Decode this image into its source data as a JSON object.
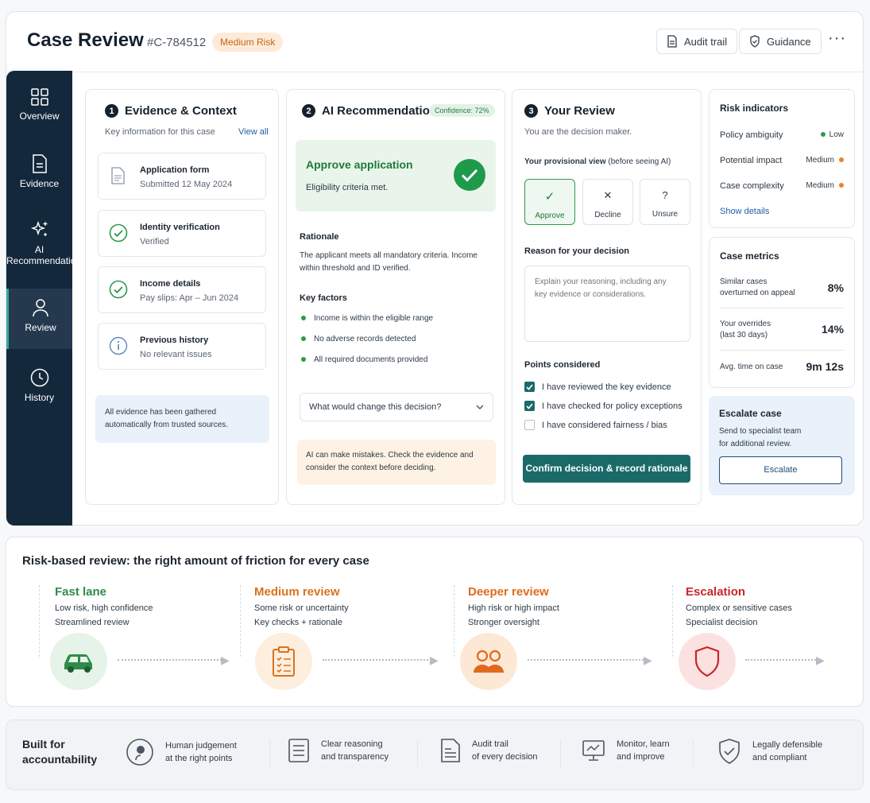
{
  "header": {
    "title": "Case Review",
    "case_id": "#C-784512",
    "risk_badge": "Medium Risk",
    "audit_trail": "Audit trail",
    "guidance": "Guidance",
    "more": "···"
  },
  "sidebar": {
    "items": [
      {
        "label": "Overview"
      },
      {
        "label": "Evidence"
      },
      {
        "label": "AI Recommendation"
      },
      {
        "label": "Review"
      },
      {
        "label": "History"
      }
    ]
  },
  "evidence": {
    "num": "1",
    "title": "Evidence & Context",
    "subtitle": "Key information for this case",
    "view_all": "View all",
    "items": [
      {
        "title": "Application form",
        "sub": "Submitted 12 May 2024"
      },
      {
        "title": "Identity verification",
        "sub": "Verified"
      },
      {
        "title": "Income details",
        "sub": "Pay slips: Apr – Jun 2024"
      },
      {
        "title": "Previous history",
        "sub": "No relevant issues"
      }
    ],
    "note": "All evidence has been gathered automatically from trusted sources."
  },
  "ai": {
    "num": "2",
    "title": "AI Recommendation",
    "confidence": "Confidence: 72%",
    "rec_title": "Approve application",
    "rec_sub": "Eligibility criteria met.",
    "rationale_h": "Rationale",
    "rationale": "The applicant meets all mandatory criteria. Income within threshold and ID verified.",
    "factors_h": "Key factors",
    "factors": [
      "Income is within the eligible range",
      "No adverse records detected",
      "All required documents provided"
    ],
    "question": "What would change this decision?",
    "warning": "AI can make mistakes. Check the evidence and consider the context before deciding."
  },
  "review": {
    "num": "3",
    "title": "Your Review",
    "subtitle": "You are the decision maker.",
    "prov_bold": "Your provisional view",
    "prov_rest": "(before seeing AI)",
    "options": [
      {
        "label": "Approve",
        "icon": "✓"
      },
      {
        "label": "Decline",
        "icon": "✕"
      },
      {
        "label": "Unsure",
        "icon": "?"
      }
    ],
    "reason_h": "Reason for your decision",
    "reason_ph": "Explain your reasoning, including any key evidence or considerations.",
    "points_h": "Points considered",
    "points": [
      {
        "label": "I have reviewed the key evidence",
        "checked": true
      },
      {
        "label": "I have checked for policy exceptions",
        "checked": true
      },
      {
        "label": "I have considered fairness / bias",
        "checked": false
      }
    ],
    "confirm": "Confirm decision & record rationale"
  },
  "risk": {
    "title": "Risk indicators",
    "rows": [
      {
        "label": "Policy ambiguity",
        "level": "Low",
        "color": "#2e9a4a"
      },
      {
        "label": "Potential impact",
        "level": "Medium",
        "color": "#e8832c"
      },
      {
        "label": "Case complexity",
        "level": "Medium",
        "color": "#e8832c"
      }
    ],
    "show_details": "Show details"
  },
  "metrics": {
    "title": "Case metrics",
    "rows": [
      {
        "l1": "Similar cases",
        "l2": "overturned on appeal",
        "value": "8%"
      },
      {
        "l1": "Your overrides",
        "l2": "(last 30 days)",
        "value": "14%"
      },
      {
        "l1": "Avg. time on case",
        "l2": "",
        "value": "9m 12s"
      }
    ]
  },
  "escalate": {
    "title": "Escalate case",
    "l1": "Send to specialist team",
    "l2": "for additional review.",
    "button": "Escalate"
  },
  "friction": {
    "title": "Risk-based review: the right amount of friction for every case",
    "lanes": [
      {
        "name": "Fast lane",
        "l1": "Low risk, high confidence",
        "l2": "Streamlined review",
        "color": "#2e8b4a"
      },
      {
        "name": "Medium review",
        "l1": "Some risk or uncertainty",
        "l2": "Key checks + rationale",
        "color": "#d8731c"
      },
      {
        "name": "Deeper review",
        "l1": "High risk or high impact",
        "l2": "Stronger oversight",
        "color": "#e06a1c"
      },
      {
        "name": "Escalation",
        "l1": "Complex or sensitive cases",
        "l2": "Specialist decision",
        "color": "#c8262c"
      }
    ]
  },
  "accountability": {
    "title_l1": "Built for",
    "title_l2": "accountability",
    "items": [
      {
        "l1": "Human judgement",
        "l2": "at the right points"
      },
      {
        "l1": "Clear reasoning",
        "l2": "and transparency"
      },
      {
        "l1": "Audit trail",
        "l2": "of every decision"
      },
      {
        "l1": "Monitor, learn",
        "l2": "and improve"
      },
      {
        "l1": "Legally defensible",
        "l2": "and compliant"
      }
    ]
  }
}
